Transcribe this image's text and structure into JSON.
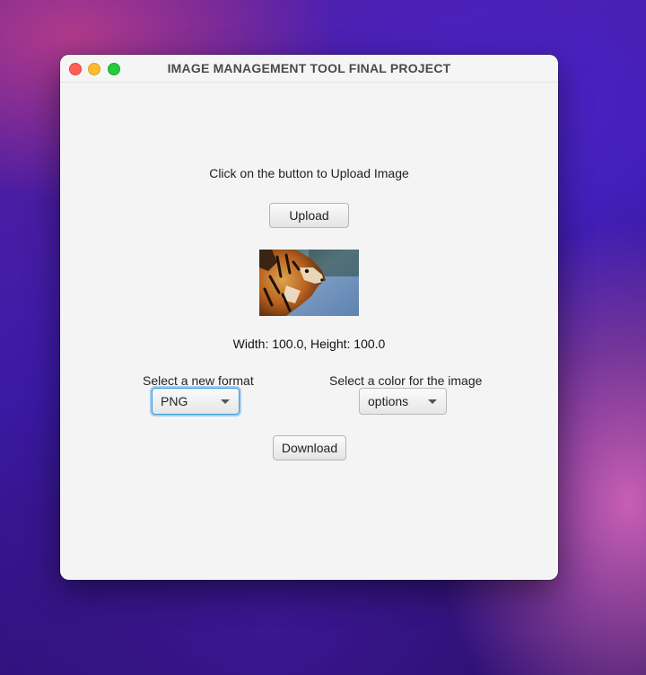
{
  "window": {
    "title": "IMAGE MANAGEMENT TOOL FINAL PROJECT"
  },
  "main": {
    "prompt": "Click on the button to Upload Image",
    "upload_label": "Upload",
    "image_dimensions": "Width: 100.0, Height: 100.0",
    "format_label": "Select a new format",
    "format_selected": "PNG",
    "color_label": "Select a color for the image",
    "color_selected": "options",
    "download_label": "Download"
  },
  "colors": {
    "close": "#fe5f57",
    "minimize": "#febc2e",
    "maximize": "#28c840",
    "focus_ring": "#3b99d9"
  },
  "icons": [
    "close-icon",
    "minimize-icon",
    "maximize-icon",
    "chevron-down-icon"
  ]
}
